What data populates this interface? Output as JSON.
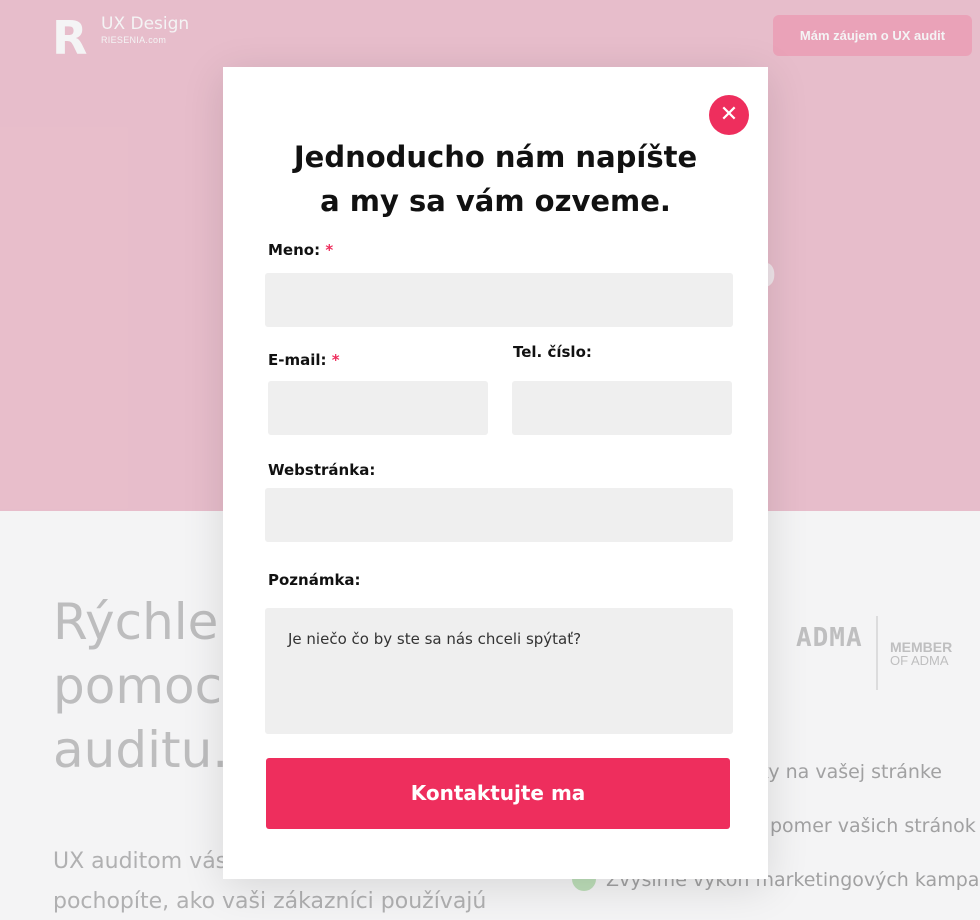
{
  "header": {
    "logo_letter": "R",
    "logo_title": "UX Design",
    "logo_subtitle": "RIESENIA.com",
    "cta_label": "Mám záujem o UX audit"
  },
  "hero": {
    "ghost_text": "o"
  },
  "main": {
    "lead": "Rýchle v",
    "lead_line2": "pomoco",
    "lead_line3": "auditu.",
    "paragraph_line1": "UX auditom vás",
    "paragraph_line2": "pochopíte, ako vaši zákazníci používajú"
  },
  "adma": {
    "logo": "ADMA",
    "member_line1": "MEMBER",
    "member_line2": "OF ADMA"
  },
  "benefits": [
    "ky na vašej stránke",
    "pomer vašich stránok",
    "Zvýšime výkon marketingových kampaní"
  ],
  "modal": {
    "close_glyph": "✕",
    "heading_line1": "Jednoducho nám napíšte",
    "heading_line2": "a my sa vám ozveme.",
    "fields": {
      "name_label": "Meno:",
      "email_label": "E-mail:",
      "phone_label": "Tel. číslo:",
      "website_label": "Webstránka:",
      "note_label": "Poznámka:",
      "required_mark": "*",
      "note_placeholder": "Je niečo čo by ste sa nás chceli spýtať?"
    },
    "submit_label": "Kontaktujte ma"
  },
  "colors": {
    "accent": "#ee2e5d",
    "hero_bg": "#f2c6d3",
    "field_bg": "#efefef"
  }
}
